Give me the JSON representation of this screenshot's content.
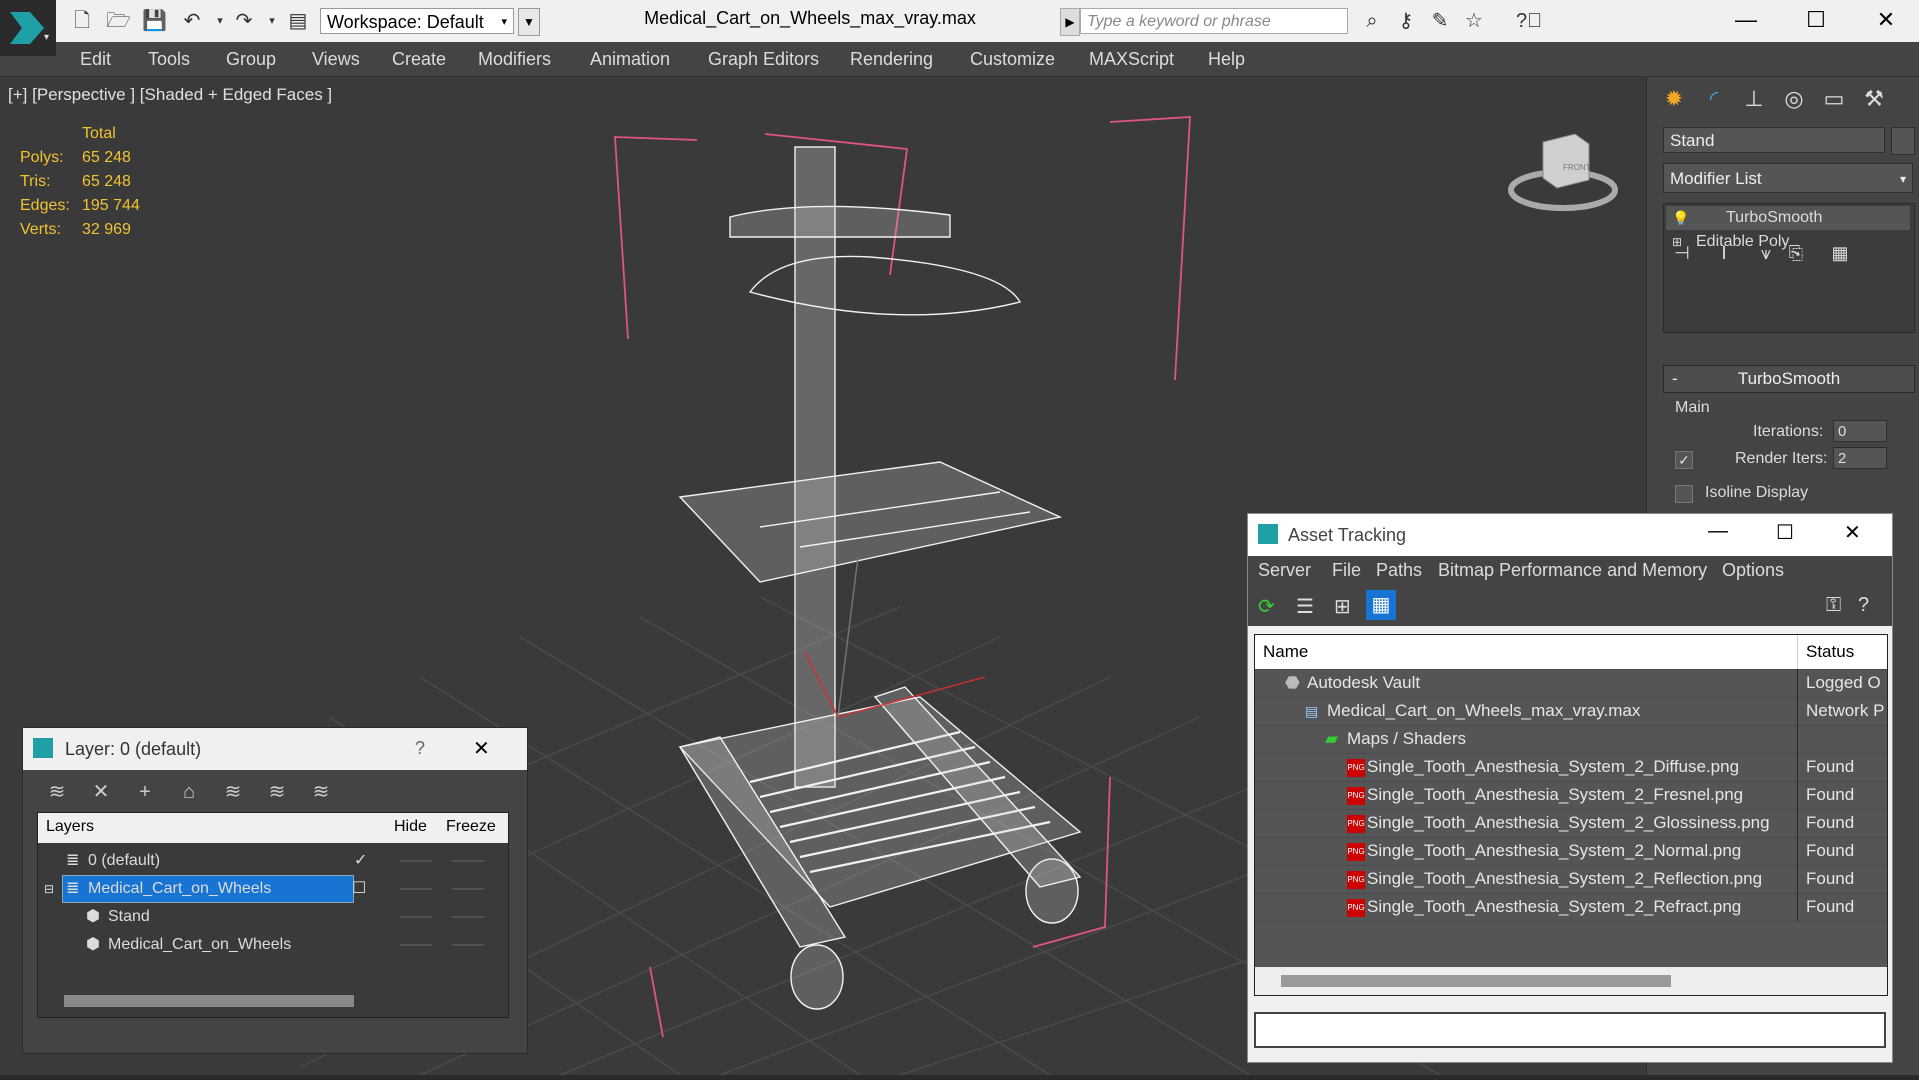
{
  "app": {
    "file_title": "Medical_Cart_on_Wheels_max_vray.max",
    "workspace": "Workspace: Default",
    "search_placeholder": "Type a keyword or phrase"
  },
  "menu": [
    "Edit",
    "Tools",
    "Group",
    "Views",
    "Create",
    "Modifiers",
    "Animation",
    "Graph Editors",
    "Rendering",
    "Customize",
    "MAXScript",
    "Help"
  ],
  "viewport": {
    "label": "[+] [Perspective ] [Shaded + Edged Faces ]",
    "stats_header": "Total",
    "stats": [
      {
        "label": "Polys:",
        "value": "65 248"
      },
      {
        "label": "Tris:",
        "value": "65 248"
      },
      {
        "label": "Edges:",
        "value": "195 744"
      },
      {
        "label": "Verts:",
        "value": "32 969"
      }
    ],
    "viewcube_label": "FRONT"
  },
  "command_panel": {
    "object_name": "Stand",
    "modifier_list": "Modifier List",
    "stack": [
      "TurboSmooth",
      "Editable Poly"
    ],
    "rollout_title": "TurboSmooth",
    "group_main": "Main",
    "iterations_label": "Iterations:",
    "iterations_value": "0",
    "render_iters_label": "Render Iters:",
    "render_iters_value": "2",
    "isoline_label": "Isoline Display",
    "collapse_sign": "-"
  },
  "layer_dialog": {
    "title": "Layer: 0 (default)",
    "help": "?",
    "columns": [
      "Layers",
      "Hide",
      "Freeze"
    ],
    "rows": [
      {
        "name": "0 (default)",
        "indent": 0,
        "selected": false
      },
      {
        "name": "Medical_Cart_on_Wheels",
        "indent": 0,
        "selected": true
      },
      {
        "name": "Stand",
        "indent": 1,
        "selected": false
      },
      {
        "name": "Medical_Cart_on_Wheels",
        "indent": 1,
        "selected": false
      }
    ]
  },
  "asset_tracking": {
    "title": "Asset Tracking",
    "menu": [
      "Server",
      "File",
      "Paths",
      "Bitmap Performance and Memory",
      "Options"
    ],
    "columns": [
      "Name",
      "Status"
    ],
    "rows": [
      {
        "name": "Autodesk Vault",
        "status": "Logged O",
        "indent": 1,
        "icon": "vault-icon"
      },
      {
        "name": "Medical_Cart_on_Wheels_max_vray.max",
        "status": "Network P",
        "indent": 2,
        "icon": "max-file-icon"
      },
      {
        "name": "Maps / Shaders",
        "status": "",
        "indent": 3,
        "icon": "maps-icon"
      },
      {
        "name": "Single_Tooth_Anesthesia_System_2_Diffuse.png",
        "status": "Found",
        "indent": 4,
        "icon": "png-icon"
      },
      {
        "name": "Single_Tooth_Anesthesia_System_2_Fresnel.png",
        "status": "Found",
        "indent": 4,
        "icon": "png-icon"
      },
      {
        "name": "Single_Tooth_Anesthesia_System_2_Glossiness.png",
        "status": "Found",
        "indent": 4,
        "icon": "png-icon"
      },
      {
        "name": "Single_Tooth_Anesthesia_System_2_Normal.png",
        "status": "Found",
        "indent": 4,
        "icon": "png-icon"
      },
      {
        "name": "Single_Tooth_Anesthesia_System_2_Reflection.png",
        "status": "Found",
        "indent": 4,
        "icon": "png-icon"
      },
      {
        "name": "Single_Tooth_Anesthesia_System_2_Refract.png",
        "status": "Found",
        "indent": 4,
        "icon": "png-icon"
      }
    ]
  },
  "colors": {
    "stats_yellow": "#f1c232",
    "selection_blue": "#1874d2",
    "bounding_pink": "#e0557f"
  }
}
